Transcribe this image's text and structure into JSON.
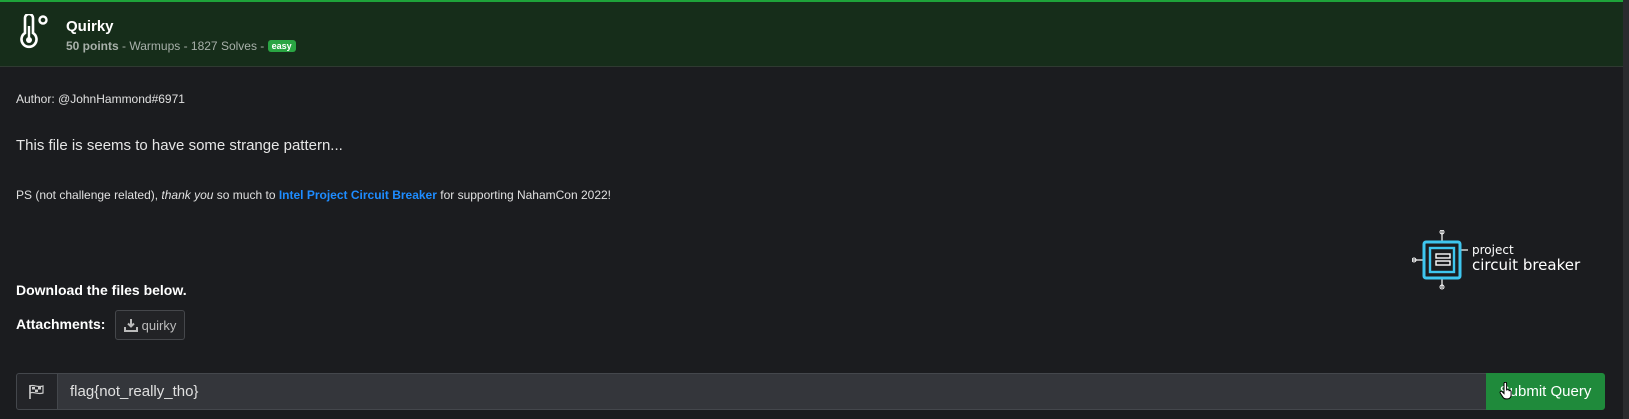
{
  "challenge": {
    "title": "Quirky",
    "points": "50 points",
    "category_solves": " - Warmups - 1827 Solves - ",
    "difficulty": "easy"
  },
  "body": {
    "author": "Author: @JohnHammond#6971",
    "description": "This file is seems to have some strange pattern...",
    "ps_prefix": "PS (not challenge related), ",
    "ps_italic": "thank you",
    "ps_middle": " so much to ",
    "ps_link": "Intel Project Circuit Breaker",
    "ps_suffix": " for supporting NahamCon 2022!",
    "logo_line1": "project",
    "logo_line2": "circuit breaker",
    "download_heading": "Download the files below.",
    "attachments_label": "Attachments:",
    "attachment_name": "quirky"
  },
  "submit_form": {
    "input_value": "flag{not_really_tho}",
    "button_label": "Submit Query"
  },
  "colors": {
    "header_bg": "#162d1a",
    "accent_green": "#2aa543",
    "link_blue": "#1e8cff",
    "logo_cyan": "#3ec6ef"
  },
  "icons": {
    "header": "thermometer-icon",
    "attachment": "download-icon",
    "input_prefix": "checkered-flag-icon",
    "cursor": "hand-pointer-icon"
  }
}
